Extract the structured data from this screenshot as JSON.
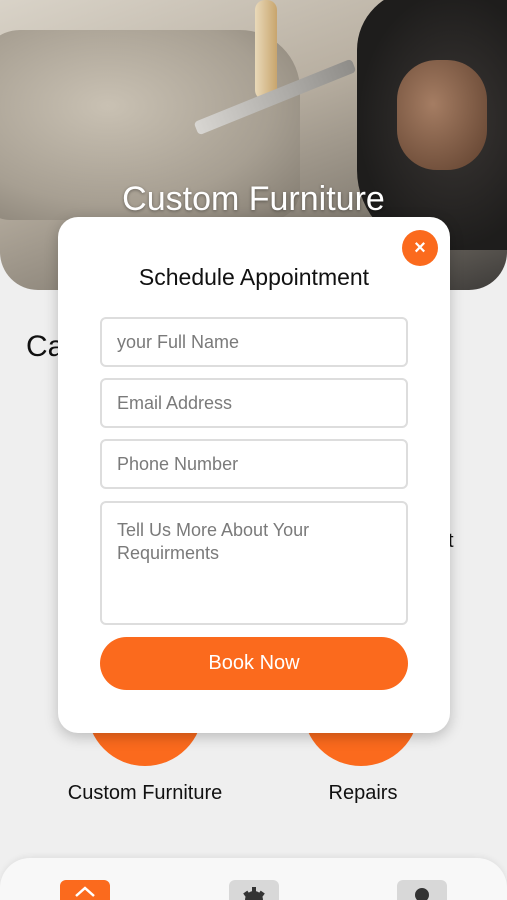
{
  "hero": {
    "title": "Custom Furniture"
  },
  "section": {
    "title": "Ca",
    "peek_text": "t"
  },
  "services": [
    {
      "label": "Custom Furniture"
    },
    {
      "label": "Repairs"
    }
  ],
  "modal": {
    "title": "Schedule Appointment",
    "close_label": "×",
    "name_placeholder": "your Full Name",
    "email_placeholder": "Email Address",
    "phone_placeholder": "Phone Number",
    "message_placeholder": "Tell Us More About Your Requirments",
    "submit_label": "Book Now"
  },
  "nav": {
    "items": [
      {
        "icon": "home-icon",
        "active": true
      },
      {
        "icon": "gear-icon",
        "active": false
      },
      {
        "icon": "person-icon",
        "active": false
      }
    ]
  },
  "colors": {
    "accent": "#fb6a1d",
    "background": "#efefef",
    "card": "#ffffff"
  }
}
